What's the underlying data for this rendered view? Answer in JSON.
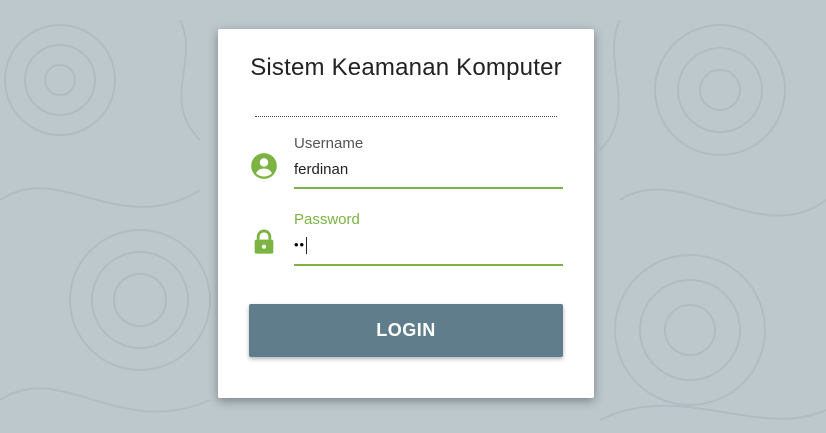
{
  "login": {
    "title": "Sistem Keamanan Komputer",
    "username": {
      "label": "Username",
      "value": "ferdinan",
      "icon": "account-circle-icon"
    },
    "password": {
      "label": "Password",
      "masked_value": "••",
      "icon": "lock-icon"
    },
    "submit_label": "LOGIN"
  },
  "colors": {
    "background": "#bcc8cc",
    "accent": "#7cb342",
    "button": "#607d8b",
    "card": "#ffffff"
  }
}
